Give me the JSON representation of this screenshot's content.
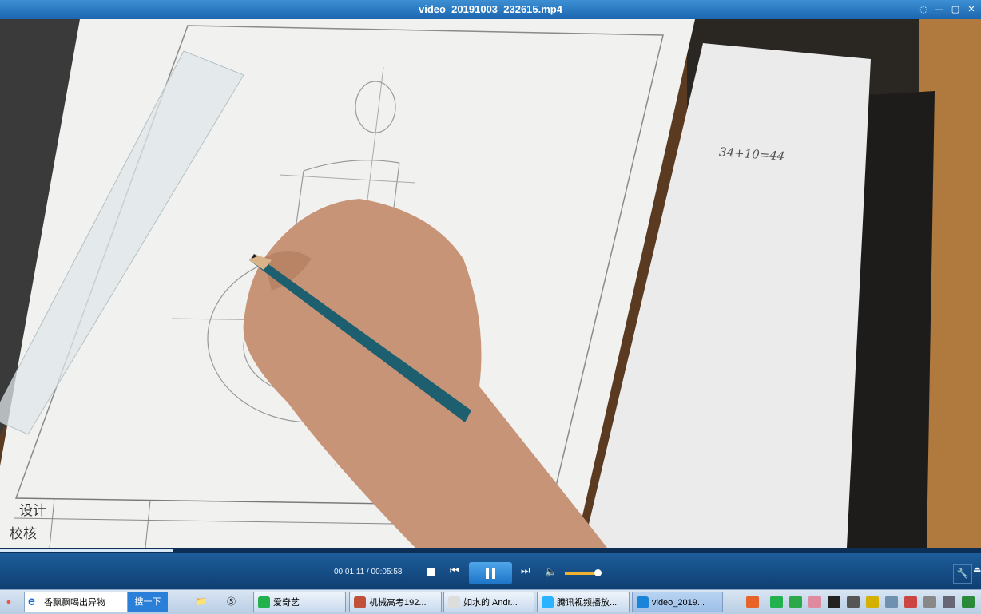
{
  "window": {
    "title": "video_20191003_232615.mp4"
  },
  "video_content": {
    "note_text": "34+10=44",
    "title_block": {
      "row1": "设计",
      "row2": "校核"
    }
  },
  "player": {
    "time_display": "00:01:11 / 00:05:58",
    "progress": 0.176,
    "volume": 0.9
  },
  "taskbar": {
    "search_text": "香飘飘喝出异物",
    "search_button": "搜一下",
    "tasks": [
      {
        "label": "爱奇艺",
        "color": "#22b14c"
      },
      {
        "label": "机械高考192...",
        "color": "#c0503a"
      },
      {
        "label": "如水的 Andr...",
        "color": "#dddddd"
      },
      {
        "label": "腾讯视频播放...",
        "color": "#2bb3ff"
      },
      {
        "label": "video_2019...",
        "color": "#1a84d8"
      }
    ]
  },
  "colors": {
    "accent": "#1d73c7",
    "title_bar": "#2a79c2"
  }
}
